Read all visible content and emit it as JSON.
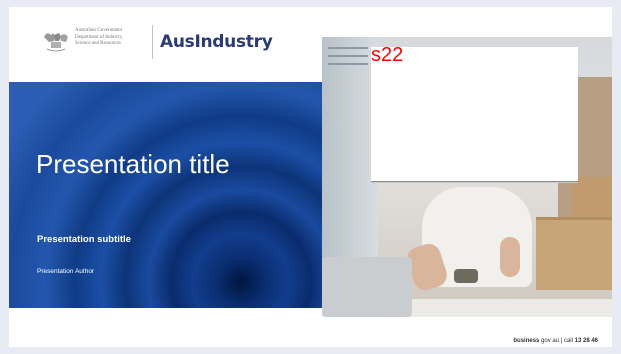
{
  "header": {
    "gov_line1": "Australian Government",
    "gov_line2": "Department of Industry,",
    "gov_line3": "Science and Resources",
    "brand": "AusIndustry"
  },
  "slide": {
    "title": "Presentation title",
    "subtitle": "Presentation subtitle",
    "author": "Presentation Author"
  },
  "redaction": {
    "label": "s22"
  },
  "footer": {
    "site_bold": "business",
    "site_rest": " gov au",
    "separator": " | ",
    "call_prefix": "call ",
    "phone": "13 28 46"
  },
  "colors": {
    "brand_navy": "#2a3a78",
    "band_blue": "#123d8c",
    "redaction_red": "#ff0000"
  }
}
